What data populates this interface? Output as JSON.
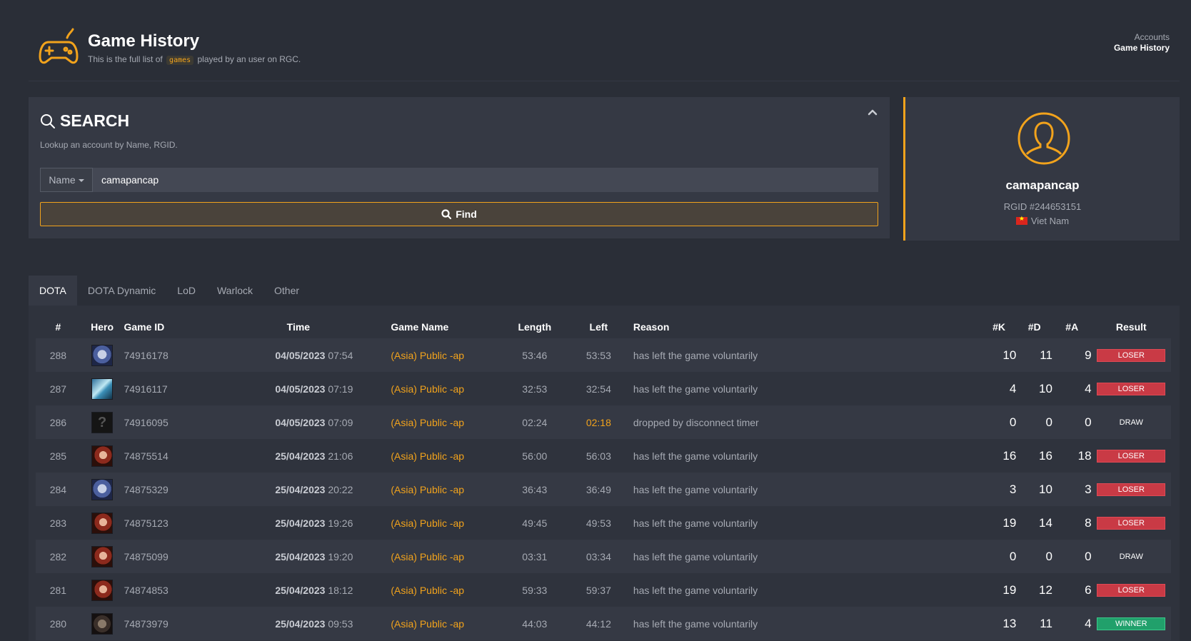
{
  "header": {
    "title": "Game History",
    "subtitle_before": "This is the full list of",
    "subtitle_code": "games",
    "subtitle_after": "played by an user on RGC.",
    "breadcrumb": [
      "Accounts",
      "Game History"
    ]
  },
  "search": {
    "title": "SEARCH",
    "subtitle": "Lookup an account by Name, RGID.",
    "dropdown_value": "Name",
    "input_value": "camapancap",
    "find_label": "Find"
  },
  "profile": {
    "name": "camapancap",
    "rgid": "RGID #244653151",
    "country": "Viet Nam"
  },
  "tabs": [
    "DOTA",
    "DOTA Dynamic",
    "LoD",
    "Warlock",
    "Other"
  ],
  "table": {
    "headers": [
      "#",
      "Hero",
      "Game ID",
      "Time",
      "Game Name",
      "Length",
      "Left",
      "Reason",
      "#K",
      "#D",
      "#A",
      "Result"
    ],
    "rows": [
      {
        "idx": "288",
        "hero": "hero-wolf",
        "gid": "74916178",
        "date": "04/05/2023",
        "time": "07:54",
        "gname": "(Asia) Public -ap",
        "length": "53:46",
        "left": "53:53",
        "left_warn": false,
        "reason": "has left the game voluntarily",
        "k": "10",
        "d": "11",
        "a": "9",
        "result": "LOSER"
      },
      {
        "idx": "287",
        "hero": "hero-ice",
        "gid": "74916117",
        "date": "04/05/2023",
        "time": "07:19",
        "gname": "(Asia) Public -ap",
        "length": "32:53",
        "left": "32:54",
        "left_warn": false,
        "reason": "has left the game voluntarily",
        "k": "4",
        "d": "10",
        "a": "4",
        "result": "LOSER"
      },
      {
        "idx": "286",
        "hero": "hero-unknown",
        "gid": "74916095",
        "date": "04/05/2023",
        "time": "07:09",
        "gname": "(Asia) Public -ap",
        "length": "02:24",
        "left": "02:18",
        "left_warn": true,
        "reason": "dropped by disconnect timer",
        "k": "0",
        "d": "0",
        "a": "0",
        "result": "DRAW"
      },
      {
        "idx": "285",
        "hero": "hero-female",
        "gid": "74875514",
        "date": "25/04/2023",
        "time": "21:06",
        "gname": "(Asia) Public -ap",
        "length": "56:00",
        "left": "56:03",
        "left_warn": false,
        "reason": "has left the game voluntarily",
        "k": "16",
        "d": "16",
        "a": "18",
        "result": "LOSER"
      },
      {
        "idx": "284",
        "hero": "hero-wolf",
        "gid": "74875329",
        "date": "25/04/2023",
        "time": "20:22",
        "gname": "(Asia) Public -ap",
        "length": "36:43",
        "left": "36:49",
        "left_warn": false,
        "reason": "has left the game voluntarily",
        "k": "3",
        "d": "10",
        "a": "3",
        "result": "LOSER"
      },
      {
        "idx": "283",
        "hero": "hero-female",
        "gid": "74875123",
        "date": "25/04/2023",
        "time": "19:26",
        "gname": "(Asia) Public -ap",
        "length": "49:45",
        "left": "49:53",
        "left_warn": false,
        "reason": "has left the game voluntarily",
        "k": "19",
        "d": "14",
        "a": "8",
        "result": "LOSER"
      },
      {
        "idx": "282",
        "hero": "hero-female",
        "gid": "74875099",
        "date": "25/04/2023",
        "time": "19:20",
        "gname": "(Asia) Public -ap",
        "length": "03:31",
        "left": "03:34",
        "left_warn": false,
        "reason": "has left the game voluntarily",
        "k": "0",
        "d": "0",
        "a": "0",
        "result": "DRAW"
      },
      {
        "idx": "281",
        "hero": "hero-female",
        "gid": "74874853",
        "date": "25/04/2023",
        "time": "18:12",
        "gname": "(Asia) Public -ap",
        "length": "59:33",
        "left": "59:37",
        "left_warn": false,
        "reason": "has left the game voluntarily",
        "k": "19",
        "d": "12",
        "a": "6",
        "result": "LOSER"
      },
      {
        "idx": "280",
        "hero": "hero-beast",
        "gid": "74873979",
        "date": "25/04/2023",
        "time": "09:53",
        "gname": "(Asia) Public -ap",
        "length": "44:03",
        "left": "44:12",
        "left_warn": false,
        "reason": "has left the game voluntarily",
        "k": "13",
        "d": "11",
        "a": "4",
        "result": "WINNER"
      }
    ]
  },
  "colors": {
    "accent": "#f2a31c",
    "background": "#2a2e37",
    "loser": "#c93a45",
    "winner": "#21a06b"
  }
}
